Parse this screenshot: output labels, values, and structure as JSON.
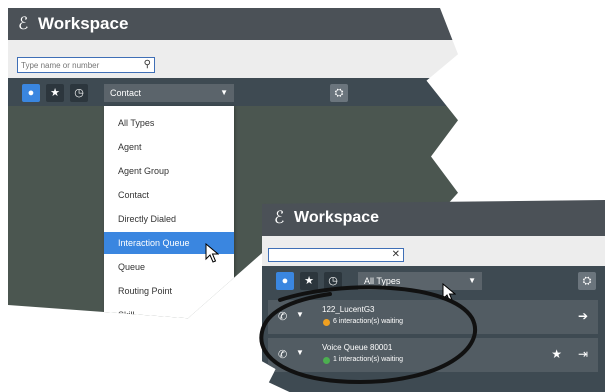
{
  "app": {
    "title": "Workspace"
  },
  "back_window": {
    "search_placeholder": "Type name or number",
    "filter_value": "Contact",
    "dropdown_options": [
      "All Types",
      "Agent",
      "Agent Group",
      "Contact",
      "Directly Dialed",
      "Interaction Queue",
      "Queue",
      "Routing Point",
      "Skill"
    ],
    "selected_option": "Interaction Queue"
  },
  "front_window": {
    "search_value": "",
    "filter_value": "All Types",
    "results": [
      {
        "name": "122_LucentG3",
        "status": "6 interaction(s) waiting",
        "status_color": "#f0a020"
      },
      {
        "name": "Voice Queue 80001",
        "status": "1 interaction(s) waiting",
        "status_color": "#4caf50"
      }
    ]
  },
  "colors": {
    "accent": "#3a86e0",
    "titlebar": "#4b5157",
    "toolbar": "#3e4a52"
  }
}
